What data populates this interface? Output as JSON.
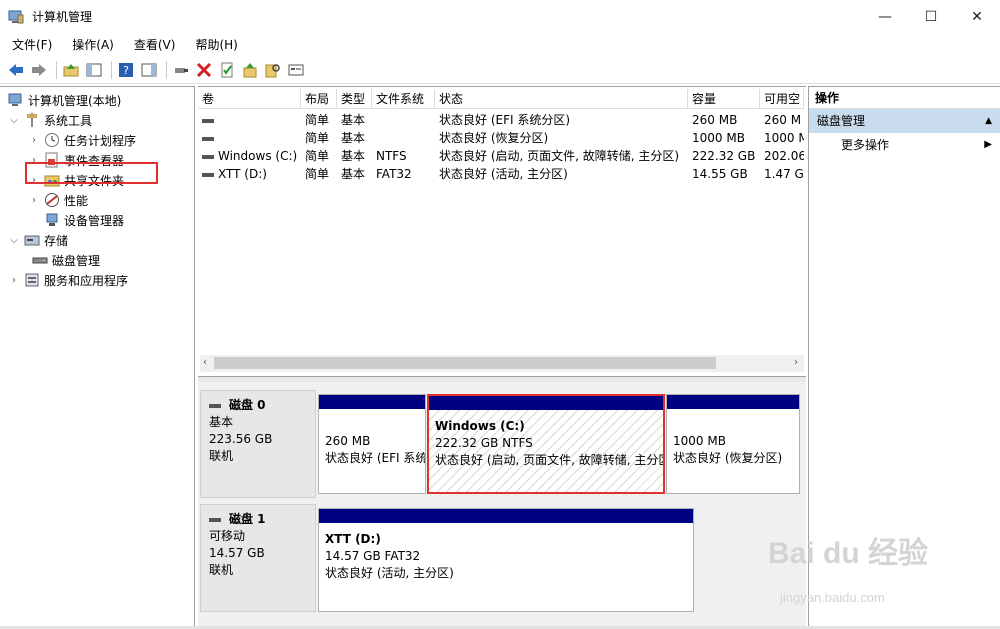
{
  "window": {
    "title": "计算机管理",
    "minimize": "—",
    "maximize": "☐",
    "close": "✕"
  },
  "menu": [
    "文件(F)",
    "操作(A)",
    "查看(V)",
    "帮助(H)"
  ],
  "tree": {
    "root": "计算机管理(本地)",
    "system_tools": "系统工具",
    "task_scheduler": "任务计划程序",
    "event_viewer": "事件查看器",
    "shared_folders": "共享文件夹",
    "performance": "性能",
    "device_manager": "设备管理器",
    "storage": "存储",
    "disk_management": "磁盘管理",
    "services_apps": "服务和应用程序"
  },
  "grid": {
    "headers": [
      "卷",
      "布局",
      "类型",
      "文件系统",
      "状态",
      "容量",
      "可用空"
    ],
    "rows": [
      [
        "",
        "简单",
        "基本",
        "",
        "状态良好 (EFI 系统分区)",
        "260 MB",
        "260 M"
      ],
      [
        "",
        "简单",
        "基本",
        "",
        "状态良好 (恢复分区)",
        "1000 MB",
        "1000 M"
      ],
      [
        "Windows (C:)",
        "简单",
        "基本",
        "NTFS",
        "状态良好 (启动, 页面文件, 故障转储, 主分区)",
        "222.32 GB",
        "202.06"
      ],
      [
        "XTT (D:)",
        "简单",
        "基本",
        "FAT32",
        "状态良好 (活动, 主分区)",
        "14.55 GB",
        "1.47 G"
      ]
    ]
  },
  "disks": [
    {
      "name": "磁盘 0",
      "type": "基本",
      "size": "223.56 GB",
      "status": "联机",
      "partitions": [
        {
          "title": "",
          "size": "260 MB",
          "status": "状态良好 (EFI 系统分区)"
        },
        {
          "title": "Windows  (C:)",
          "size": "222.32 GB NTFS",
          "status": "状态良好 (启动, 页面文件, 故障转储, 主分区)"
        },
        {
          "title": "",
          "size": "1000 MB",
          "status": "状态良好 (恢复分区)"
        }
      ]
    },
    {
      "name": "磁盘 1",
      "type": "可移动",
      "size": "14.57 GB",
      "status": "联机",
      "partitions": [
        {
          "title": "XTT  (D:)",
          "size": "14.57 GB FAT32",
          "status": "状态良好 (活动, 主分区)"
        }
      ]
    }
  ],
  "actions": {
    "header": "操作",
    "section": "磁盘管理",
    "more": "更多操作"
  },
  "watermark": {
    "brand": "Bai du 经验",
    "url": "jingyan.baidu.com"
  }
}
